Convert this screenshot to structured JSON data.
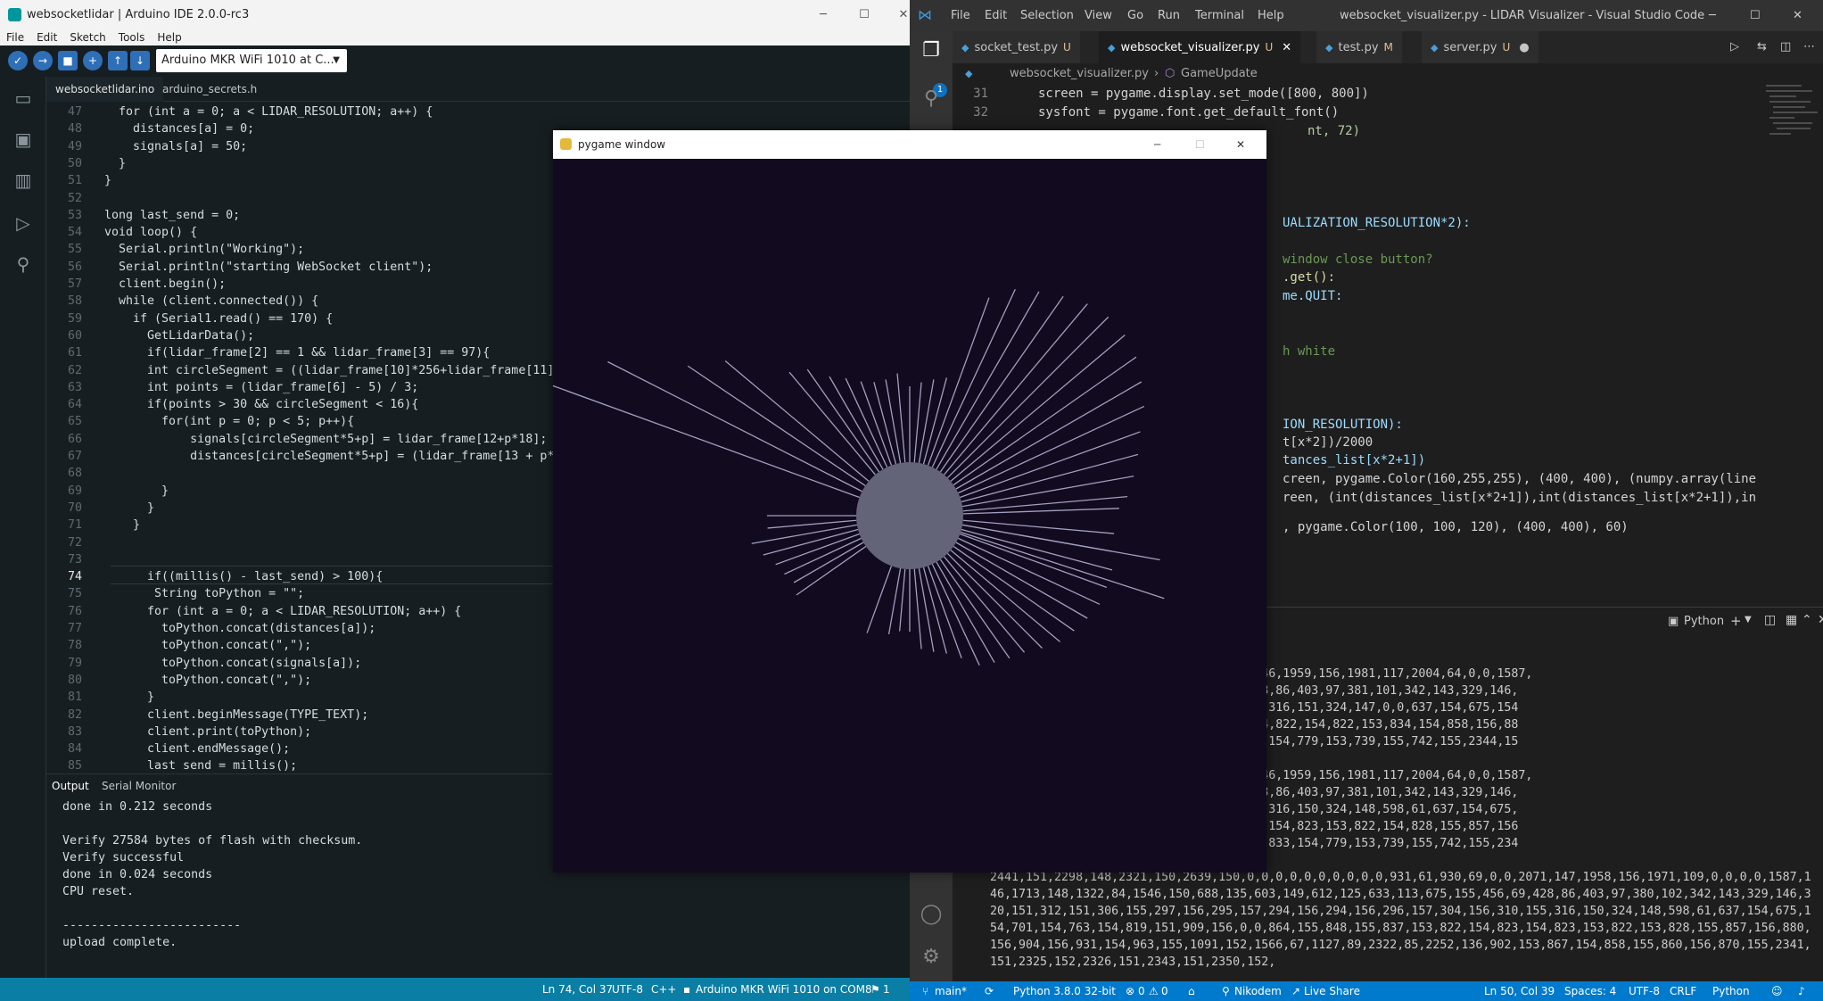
{
  "arduino": {
    "title": "websocketlidar | Arduino IDE 2.0.0-rc3",
    "menu": [
      "File",
      "Edit",
      "Sketch",
      "Tools",
      "Help"
    ],
    "board": "Arduino MKR WiFi 1010 at C...",
    "tabs": [
      "websocketlidar.ino",
      "arduino_secrets.h"
    ],
    "code": [
      {
        "n": "47",
        "t": "  for (int a = 0; a < LIDAR_RESOLUTION; a++) {"
      },
      {
        "n": "48",
        "t": "    distances[a] = 0;"
      },
      {
        "n": "49",
        "t": "    signals[a] = 50;"
      },
      {
        "n": "50",
        "t": "  }"
      },
      {
        "n": "51",
        "t": "}"
      },
      {
        "n": "52",
        "t": ""
      },
      {
        "n": "53",
        "t": "long last_send = 0;"
      },
      {
        "n": "54",
        "t": "void loop() {"
      },
      {
        "n": "55",
        "t": "  Serial.println(\"Working\");"
      },
      {
        "n": "56",
        "t": "  Serial.println(\"starting WebSocket client\");"
      },
      {
        "n": "57",
        "t": "  client.begin();"
      },
      {
        "n": "58",
        "t": "  while (client.connected()) {"
      },
      {
        "n": "59",
        "t": "    if (Serial1.read() == 170) {"
      },
      {
        "n": "60",
        "t": "      GetLidarData();"
      },
      {
        "n": "61",
        "t": "      if(lidar_frame[2] == 1 && lidar_frame[3] == 97){"
      },
      {
        "n": "62",
        "t": "      int circleSegment = ((lidar_frame[10]*256+lidar_frame[11])/"
      },
      {
        "n": "63",
        "t": "      int points = (lidar_frame[6] - 5) / 3;"
      },
      {
        "n": "64",
        "t": "      if(points > 30 && circleSegment < 16){"
      },
      {
        "n": "65",
        "t": "        for(int p = 0; p < 5; p++){"
      },
      {
        "n": "66",
        "t": "            signals[circleSegment*5+p] = lidar_frame[12+p*18];"
      },
      {
        "n": "67",
        "t": "            distances[circleSegment*5+p] = (lidar_frame[13 + p*18"
      },
      {
        "n": "68",
        "t": ""
      },
      {
        "n": "69",
        "t": "        }"
      },
      {
        "n": "70",
        "t": "      }"
      },
      {
        "n": "71",
        "t": "    }"
      },
      {
        "n": "72",
        "t": ""
      },
      {
        "n": "73",
        "t": ""
      },
      {
        "n": "74",
        "t": "      if((millis() - last_send) > 100){"
      },
      {
        "n": "75",
        "t": "       String toPython = \"\";"
      },
      {
        "n": "76",
        "t": "      for (int a = 0; a < LIDAR_RESOLUTION; a++) {"
      },
      {
        "n": "77",
        "t": "        toPython.concat(distances[a]);"
      },
      {
        "n": "78",
        "t": "        toPython.concat(\",\");"
      },
      {
        "n": "79",
        "t": "        toPython.concat(signals[a]);"
      },
      {
        "n": "80",
        "t": "        toPython.concat(\",\");"
      },
      {
        "n": "81",
        "t": "      }"
      },
      {
        "n": "82",
        "t": "      client.beginMessage(TYPE_TEXT);"
      },
      {
        "n": "83",
        "t": "      client.print(toPython);"
      },
      {
        "n": "84",
        "t": "      client.endMessage();"
      },
      {
        "n": "85",
        "t": "      last_send = millis();"
      }
    ],
    "output_tabs": [
      "Output",
      "Serial Monitor"
    ],
    "output_lines": [
      "done in 0.212 seconds",
      "",
      "Verify 27584 bytes of flash with checksum.",
      "Verify successful",
      "done in 0.024 seconds",
      "CPU reset.",
      "",
      "-------------------------",
      "upload complete."
    ],
    "status": {
      "position": "Ln 74, Col 37",
      "encoding": "UTF-8",
      "language": "C++",
      "board": "Arduino MKR WiFi 1010 on COM8",
      "notifications": "1"
    }
  },
  "vscode": {
    "title": "websocket_visualizer.py - LIDAR Visualizer - Visual Studio Code",
    "menu": [
      "File",
      "Edit",
      "Selection",
      "View",
      "Go",
      "Run",
      "Terminal",
      "Help"
    ],
    "explorer_badge": "1",
    "tabs": [
      {
        "label": "socket_test.py",
        "flag": "U"
      },
      {
        "label": "websocket_visualizer.py",
        "flag": "U"
      },
      {
        "label": "test.py",
        "flag": "M"
      },
      {
        "label": "server.py",
        "flag": "U"
      }
    ],
    "breadcrumb": {
      "file": "websocket_visualizer.py",
      "symbol": "GameUpdate"
    },
    "code_lines": [
      {
        "n": "31",
        "t": "screen = pygame.display.set_mode([800, 800])"
      },
      {
        "n": "32",
        "t": "sysfont = pygame.font.get_default_font()"
      }
    ],
    "code_fragments": [
      "nt, 72)",
      "UALIZATION_RESOLUTION*2):",
      "window close button?",
      ".get():",
      "me.QUIT:",
      "h white",
      "ION_RESOLUTION):",
      "t[x*2])/2000",
      "tances_list[x*2+1])",
      "creen, pygame.Color(160,255,255), (400, 400), (numpy.array(line",
      "reen, (int(distances_list[x*2+1]),int(distances_list[x*2+1]),in",
      ", pygame.Color(100, 100, 120), (400, 400), 60)"
    ],
    "terminal_shell": "Python",
    "terminal_lines": [
      ",0,0,0,0,0,0,0,0,0,0,927,68,0,0,2062,146,1959,156,1981,117,2004,64,0,0,1587,",
      ",149,614,119,633,115,674,153,456,70,428,86,403,97,381,101,342,143,329,146,",
      "94,156,294,156,296,158,304,156,309,155,316,151,324,147,0,0,637,154,675,154",
      "869,155,849,154,837,153,822,154,823,154,822,154,822,153,834,154,858,156,88",
      "66,69,1123,82,2343,74,2239,131,0,0,833,154,779,153,739,155,742,155,2344,15",
      "",
      ",0,0,0,0,0,0,0,0,0,0,927,68,0,0,2062,146,1959,156,1981,117,2004,64,0,0,1587,",
      ",149,614,119,633,115,674,153,456,70,428,86,403,97,381,101,342,143,329,146,",
      "94,156,294,156,296,158,304,156,310,155,316,150,324,148,598,61,637,154,675,",
      "54,869,155,849,154,837,153,821,153,823,154,823,153,822,154,828,155,857,156",
      "2,1566,69,1123,82,2343,74,2239,131,0,0,833,154,779,153,739,155,742,155,234",
      "",
      "2441,151,2298,148,2321,150,2639,150,0,0,0,0,0,0,0,0,0,0,931,61,930,69,0,0,2071,147,1958,156,1971,109,0,0,0,0,1587,1",
      "46,1713,148,1322,84,1546,150,688,135,603,149,612,125,633,113,675,155,456,69,428,86,403,97,380,102,342,143,329,146,3",
      "20,151,312,151,306,155,297,156,295,157,294,156,294,156,296,157,304,156,310,155,316,150,324,148,598,61,637,154,675,1",
      "54,701,154,763,154,819,151,909,156,0,0,864,155,848,155,837,153,822,154,823,154,823,153,822,153,828,155,857,156,880,",
      "156,904,156,931,154,963,155,1091,152,1566,67,1127,89,2322,85,2252,136,902,153,867,154,858,155,860,156,870,155,2341,",
      "151,2325,152,2326,151,2343,151,2350,152,"
    ],
    "status": {
      "branch": "main*",
      "python": "Python 3.8.0 32-bit",
      "errors": "0",
      "warnings": "0",
      "user": "Nikodem",
      "liveshare": "Live Share",
      "position": "Ln 50, Col 39",
      "spaces": "Spaces: 4",
      "encoding": "UTF-8",
      "eol": "CRLF",
      "language": "Python"
    }
  },
  "pygame": {
    "title": "pygame window",
    "colors": {
      "background": "#120a1e",
      "circle": "#646478",
      "beams": "#a0a0c0"
    }
  },
  "colors": {
    "arduino_status": "#0a7ea4",
    "vscode_status": "#007acc",
    "arduino_editor_bg": "#171e21",
    "vscode_editor_bg": "#1e1e1e"
  }
}
